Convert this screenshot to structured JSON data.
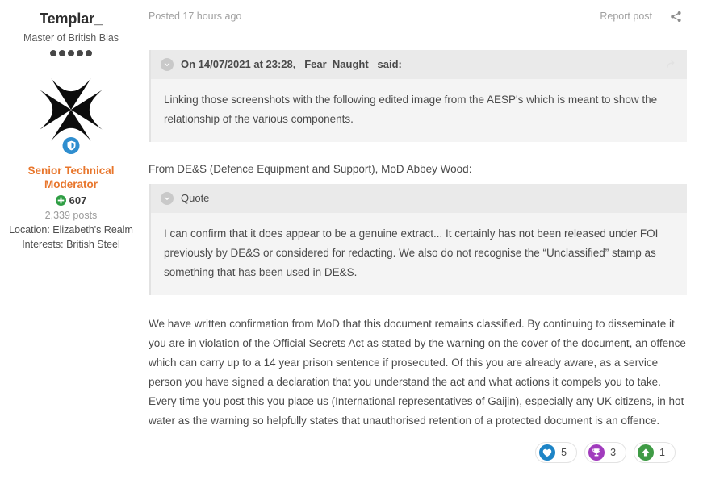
{
  "author": {
    "name": "Templar_",
    "title": "Master of British Bias",
    "rank_pips": 5,
    "avatar_icon": "maltese-cross-avatar",
    "moderator_badge_icon": "shield-icon",
    "group": "Senior Technical Moderator",
    "reputation": "607",
    "reputation_icon": "plus-circle-icon",
    "post_count": "2,339 posts",
    "location": "Location: Elizabeth's Realm",
    "interests": "Interests: British Steel",
    "group_color": "#e8762c",
    "badge_color": "#2f8ecf",
    "reputation_color": "#2f9e44"
  },
  "header": {
    "posted_time": "Posted 17 hours ago",
    "report_label": "Report post",
    "share_icon": "share-icon"
  },
  "quotes": [
    {
      "citation": "On 14/07/2021 at 23:28, _Fear_Naught_ said:",
      "chevron_icon": "chevron-down-icon",
      "jump_icon": "jump-to-quote-arrow-icon",
      "text": "Linking those screenshots with the following edited image from the AESP's which is meant to show the relationship of the various components."
    },
    {
      "citation": "Quote",
      "chevron_icon": "chevron-down-icon",
      "jump_icon": "",
      "text": "I can confirm that it does appear to be a genuine extract...  It certainly has not been released under FOI previously by DE&S or considered for redacting.  We also do not recognise the “Unclassified” stamp as something that has been used in DE&S."
    }
  ],
  "body": {
    "intro": "From DE&S (Defence Equipment and Support), MoD Abbey Wood:",
    "main": "We have written confirmation from MoD that this document remains classified. By continuing to disseminate it you are in violation of the Official Secrets Act as stated by the warning on the cover of the document, an offence which can carry up to a 14 year prison sentence if prosecuted. Of this you are already aware, as a service person you have signed a declaration that you understand the act and what actions it compels you to take. Every time you post this you place us (International representatives of Gaijin), especially any UK citizens, in hot water as the warning so helpfully states that unauthorised retention of a protected document is an offence."
  },
  "reactions": [
    {
      "icon": "heart-icon",
      "label": "Like",
      "count": "5",
      "color": "#1d84c6"
    },
    {
      "icon": "trophy-icon",
      "label": "Thanks",
      "count": "3",
      "color": "#a13bbd"
    },
    {
      "icon": "arrow-up-icon",
      "label": "Upvote",
      "count": "1",
      "color": "#3f9b45"
    }
  ]
}
